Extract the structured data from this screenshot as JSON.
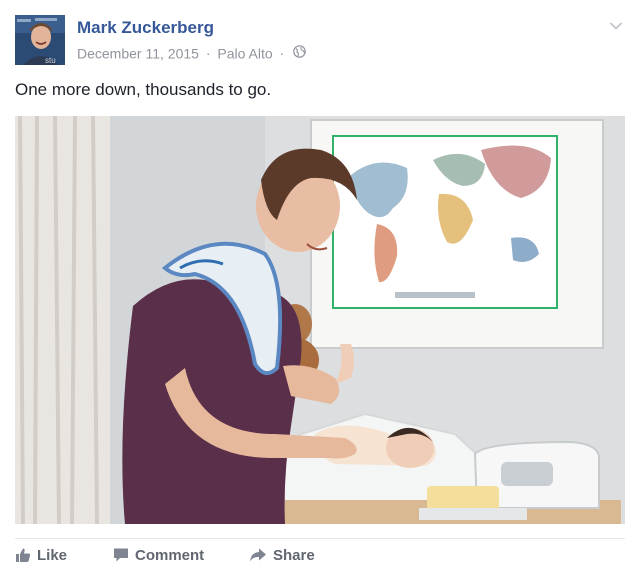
{
  "post": {
    "author": "Mark Zuckerberg",
    "date": "December 11, 2015",
    "separator": "·",
    "location": "Palo Alto",
    "privacy_icon": "globe-icon",
    "text": "One more down, thousands to go.",
    "photo": {
      "subject": "man changing a baby's diaper beside a framed world map"
    },
    "avatar_overlay": "stu"
  },
  "actions": {
    "like": "Like",
    "comment": "Comment",
    "share": "Share"
  },
  "colors": {
    "name_link": "#365899",
    "meta_gray": "#90949c",
    "action_gray": "#616770",
    "map_frame_green": "#2fb36b"
  }
}
